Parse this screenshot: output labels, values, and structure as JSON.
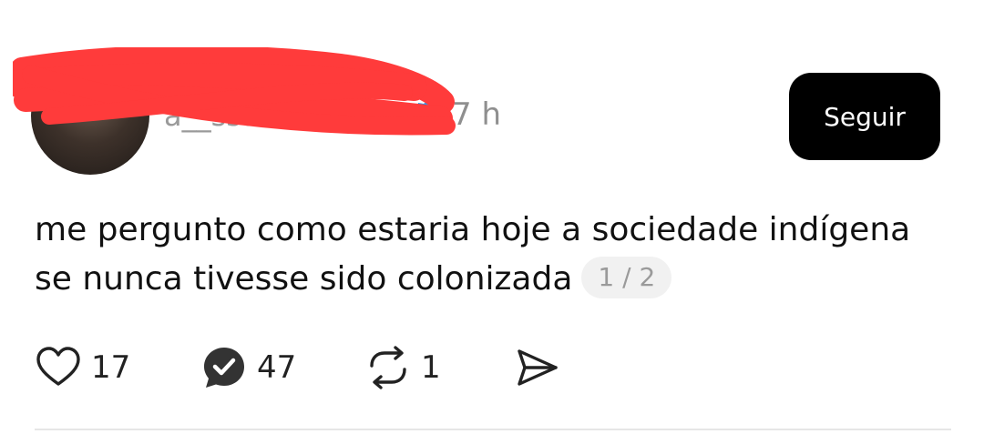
{
  "post": {
    "username": "a__ssa",
    "timestamp": "7 h",
    "follow_label": "Seguir",
    "text_line1": "me pergunto como estaria hoje a sociedade indígena",
    "text_line2": "se nunca tivesse sido colonizada",
    "thread_badge": "1 / 2"
  },
  "actions": {
    "likes": "17",
    "replies": "47",
    "reposts": "1"
  },
  "icons": {
    "like": "heart-icon",
    "reply": "comment-check-icon",
    "repost": "repost-icon",
    "share": "send-icon",
    "verified": "verified-badge-icon"
  },
  "colors": {
    "button_bg": "#000000",
    "button_text": "#ffffff",
    "muted": "#8f8f8f",
    "verified": "#1d9bf0",
    "redaction": "#ff3b3b"
  }
}
